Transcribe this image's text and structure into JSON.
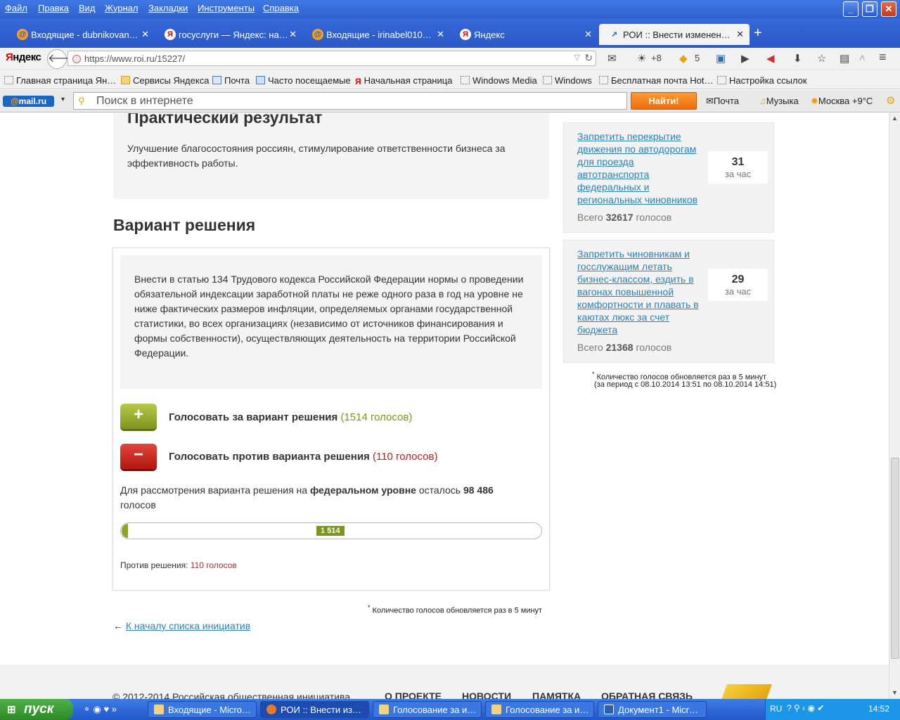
{
  "window": {
    "menu": [
      "Файл",
      "Правка",
      "Вид",
      "Журнал",
      "Закладки",
      "Инструменты",
      "Справка"
    ],
    "tabs": [
      {
        "title": "Входящие - dubnikovan…",
        "icon": "mail-icon"
      },
      {
        "title": "госуслуги — Яндекс: на…",
        "icon": "yandex-icon"
      },
      {
        "title": "Входящие - irinabel010…",
        "icon": "mail-icon"
      },
      {
        "title": "Яндекс",
        "icon": "yandex-icon"
      },
      {
        "title": "РОИ :: Внести изменен…",
        "icon": "roi-icon"
      }
    ],
    "new_tab": "+",
    "browser_logo": {
      "prefix": "Я",
      "rest": "ндекс"
    },
    "url": "https://www.roi.ru/15227/",
    "weather": "+8",
    "notifications": "5",
    "bookmarks": [
      "Главная страница Ян…",
      "Сервисы Яндекса",
      "Почта",
      "Часто посещаемые",
      "Начальная страница",
      "Windows Media",
      "Windows",
      "Бесплатная почта Hot…",
      "Настройка ссылок"
    ],
    "mailru": {
      "logo_at": "@",
      "logo_text": "mail.ru",
      "search_placeholder": "Поиск в интернете",
      "find_button": "Найти!",
      "mail_link": "Почта",
      "music_link": "Музыка",
      "weather_link": "Москва +9°С"
    }
  },
  "page": {
    "practical_result": {
      "heading": "Практический результат",
      "text": "Улучшение благосостояния россиян, стимулирование ответственности бизнеса за эффективность работы."
    },
    "solution": {
      "heading": "Вариант решения",
      "text": "Внести в статью 134 Трудового кодекса Российской Федерации нормы о проведении обязательной индексации заработной платы не реже одного раза в год на уровне не ниже фактических размеров инфляции, определяемых органами государственной статистики, во всех организациях (независимо от источников финансирования и формы собственности), осуществляющих деятельность на территории Российской Федерации.",
      "vote_for": {
        "symbol": "+",
        "label": "Голосовать за вариант решения",
        "count": "(1514 голосов)"
      },
      "vote_against": {
        "symbol": "−",
        "label": "Голосовать против варианта решения",
        "count": "(110 голосов)"
      },
      "remaining": {
        "prefix": "Для рассмотрения варианта решения на",
        "level": "федеральном уровне",
        "middle": "осталось",
        "number": "98 486",
        "suffix": "голосов"
      },
      "progress": {
        "badge": "1 514",
        "fraction": 0.015
      },
      "against_summary": {
        "label": "Против решения:",
        "value": "110 голосов"
      },
      "footnote": "Количество голосов обновляется раз в 5 минут"
    },
    "back_link": {
      "arrow": "←",
      "label": "К началу списка инициатив"
    },
    "sidebar": {
      "items": [
        {
          "title": "Запретить перекрытие движения по автодорогам для проезда автотранспорта федеральных и региональных чиновников",
          "count": "31",
          "unit": "за час",
          "total_prefix": "Всего",
          "total": "32617",
          "total_suffix": "голосов"
        },
        {
          "title": "Запретить чиновникам и госслужащим летать бизнес-классом, ездить в вагонах повышенной комфортности и плавать в каютах люкс за счет бюджета",
          "count": "29",
          "unit": "за час",
          "total_prefix": "Всего",
          "total": "21368",
          "total_suffix": "голосов"
        }
      ],
      "footnote_line1": "Количество голосов обновляется раз в 5 минут",
      "footnote_line2": "(за период с 08.10.2014 13:51 по 08.10.2014 14:51)"
    },
    "footer": {
      "copyright": "© 2012-2014 Российская общественная инициатива",
      "links": [
        "О проекте",
        "Новости",
        "Памятка",
        "Обратная связь"
      ]
    }
  },
  "taskbar": {
    "start": "пуск",
    "tasks": [
      "Входящие - Micro…",
      "РОИ :: Внести из…",
      "Голосование за и…",
      "Голосование за и…",
      "Документ1 - Micr…"
    ],
    "lang": "RU",
    "time": "14:52"
  }
}
